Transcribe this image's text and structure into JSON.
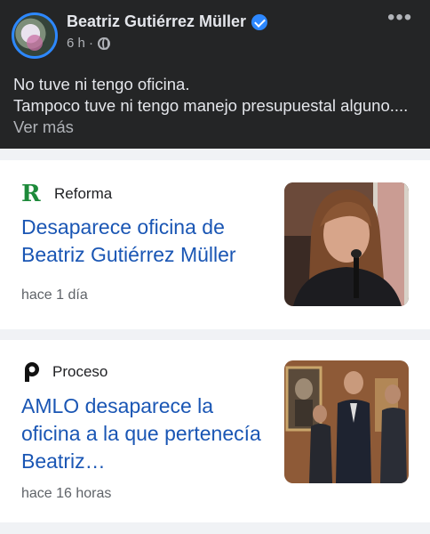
{
  "post": {
    "author": "Beatriz Gutiérrez Müller",
    "time": "6 h ·",
    "text_line1": "No tuve ni tengo oficina.",
    "text_line2": "Tampoco tuve ni tengo manejo presupuestal alguno.... ",
    "see_more": "Ver más",
    "more_menu": "•••",
    "icons": {
      "verified": "verified-badge-icon",
      "audience": "globe-icon"
    }
  },
  "cards": [
    {
      "source": "Reforma",
      "logo_text": "R",
      "headline": "Desaparece oficina de Beatriz Gutiérrez Müller",
      "time": "hace 1 día"
    },
    {
      "source": "Proceso",
      "headline": "AMLO desaparece la oficina a la que pertenecía Beatriz…",
      "time": "hace 16 horas"
    }
  ],
  "colors": {
    "post_bg": "#242526",
    "headline": "#1a56b4",
    "verified": "#2d88ff",
    "reforma_logo": "#1d8a3a"
  }
}
